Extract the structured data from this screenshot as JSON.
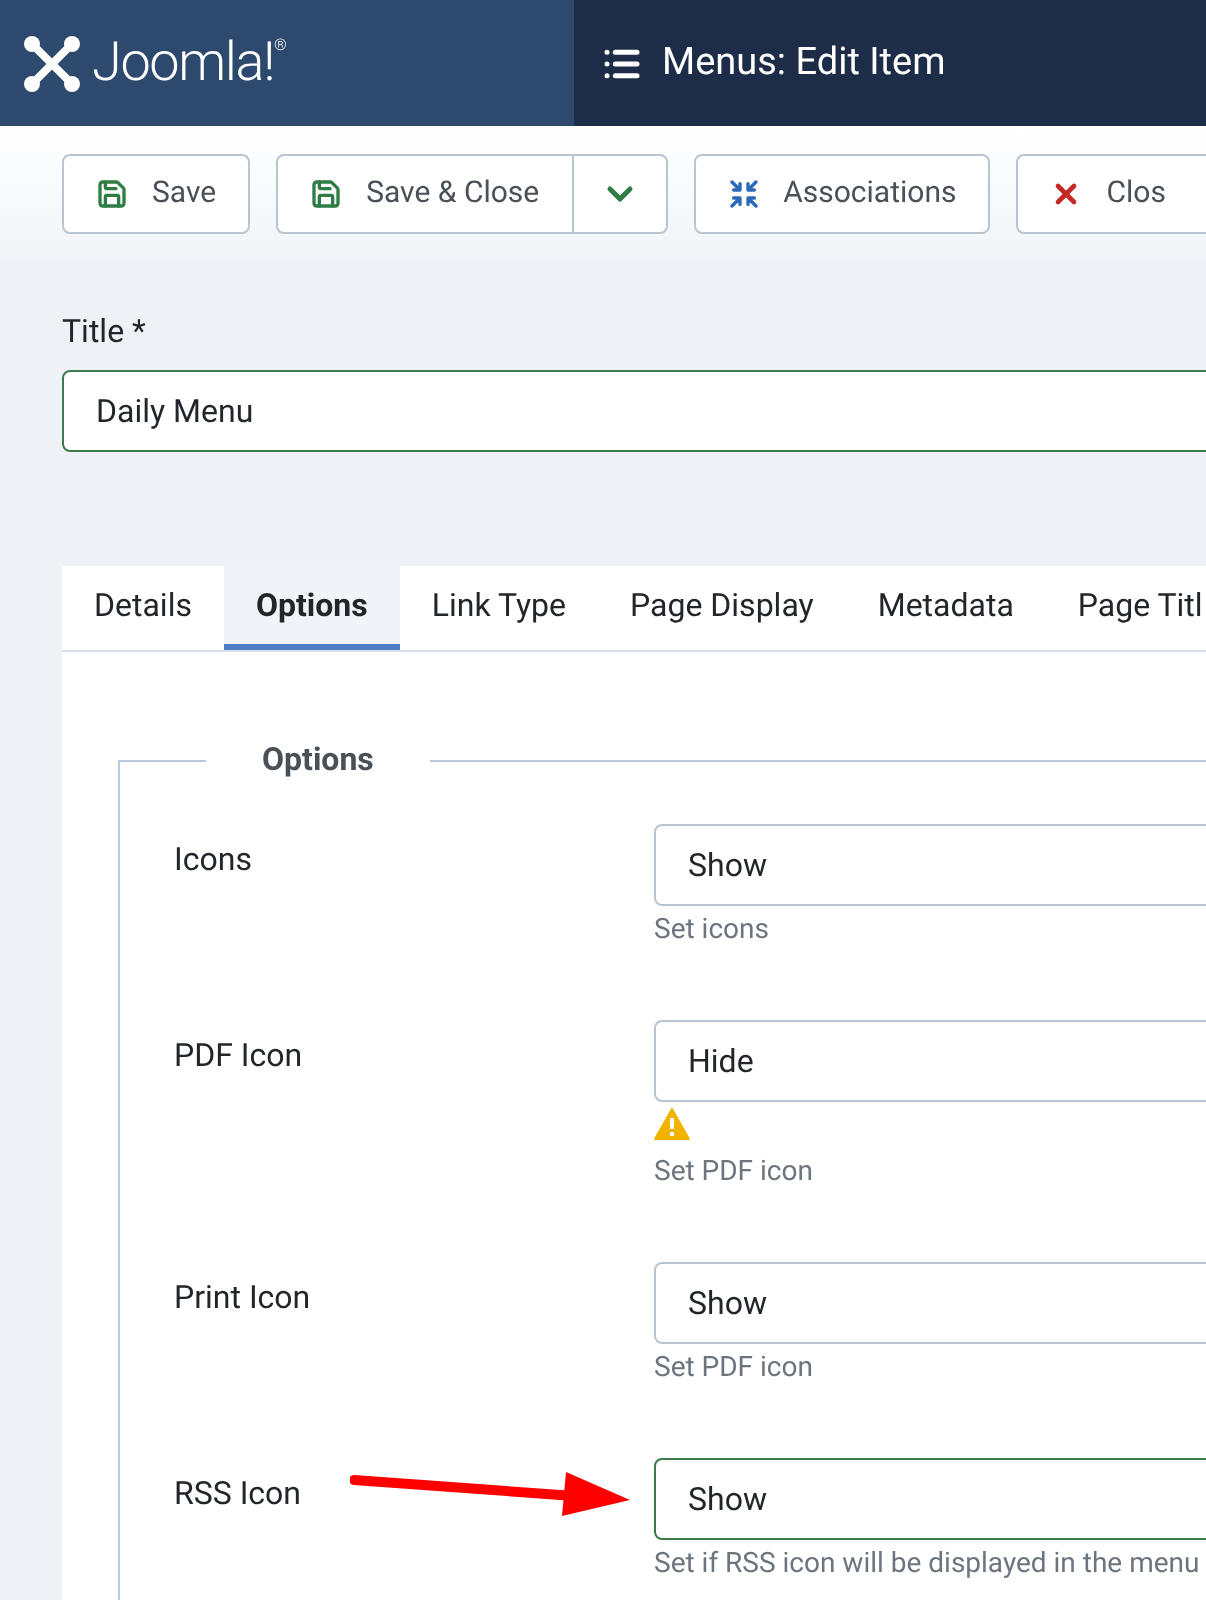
{
  "header": {
    "logo_text": "Joomla!$^{®}$",
    "title": "Menus: Edit Item"
  },
  "toolbar": {
    "buttons": [
      {
        "kind": "save",
        "label": "Save"
      },
      {
        "kind": "save_split",
        "label": "Save & Close"
      },
      {
        "kind": "associations",
        "label": "Associations"
      },
      {
        "kind": "close",
        "label": "Clos"
      }
    ]
  },
  "title_field": {
    "label": "Title *",
    "value": "Daily Menu",
    "valid": true
  },
  "tabs": [
    {
      "label": "Details",
      "selected": false
    },
    {
      "label": "Options",
      "selected": true
    },
    {
      "label": "Link Type",
      "selected": false
    },
    {
      "label": "Page Display",
      "selected": false
    },
    {
      "label": "Metadata",
      "selected": false
    },
    {
      "label": "Page Titl",
      "selected": false
    }
  ],
  "fieldset": {
    "legend": "Options",
    "fields": [
      {
        "label": "Icons",
        "value": "Show",
        "help": "Set icons",
        "warning": false,
        "valid": false,
        "annotated": false
      },
      {
        "label": "PDF Icon",
        "value": "Hide",
        "help": "Set PDF icon",
        "warning": true,
        "valid": false,
        "annotated": false
      },
      {
        "label": "Print Icon",
        "value": "Show",
        "help": "Set PDF icon",
        "warning": false,
        "valid": false,
        "annotated": false
      },
      {
        "label": "RSS Icon",
        "value": "Show",
        "help": "Set if RSS icon will be displayed in the menu",
        "warning": false,
        "valid": true,
        "annotated": true
      }
    ]
  }
}
